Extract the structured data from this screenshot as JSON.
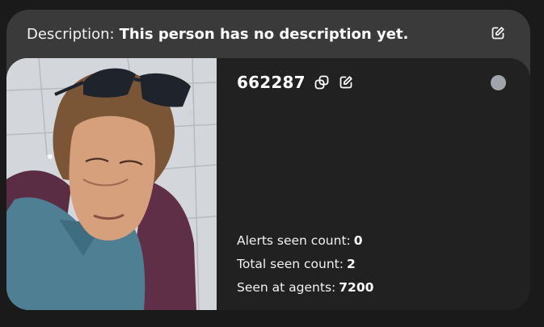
{
  "description": {
    "label": "Description:",
    "text": "This person has no description yet."
  },
  "person": {
    "id": "662287",
    "status_color": "#a0a4ac"
  },
  "stats": [
    {
      "label": "Alerts seen count:",
      "value": "0"
    },
    {
      "label": "Total seen count:",
      "value": "2"
    },
    {
      "label": "Seen at agents:",
      "value": "7200"
    }
  ],
  "icons": {
    "description_edit": "edit-icon",
    "copy": "copy-icon",
    "id_edit": "edit-icon"
  },
  "colors": {
    "card_bg": "#3a3a3a",
    "inner_bg": "#212121",
    "page_bg": "#1a1a1a"
  }
}
